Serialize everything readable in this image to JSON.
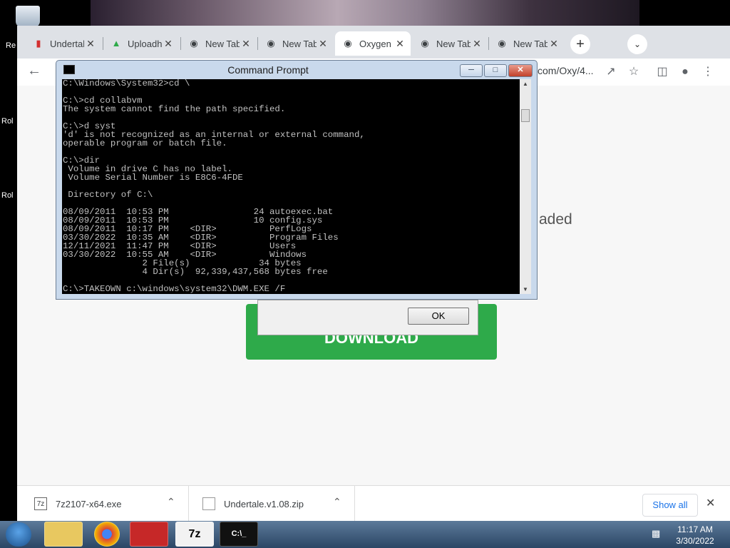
{
  "desktop": {
    "recycle_label": "Re",
    "icon2_label": "Rol",
    "icon3_label": "Rol"
  },
  "browser": {
    "tabs": [
      {
        "title": "Undertale",
        "icon": "red-shield-icon"
      },
      {
        "title": "Uploadh",
        "icon": "upload-icon"
      },
      {
        "title": "New Tab",
        "icon": "chrome-icon"
      },
      {
        "title": "New Tab",
        "icon": "chrome-icon"
      },
      {
        "title": "Oxygen",
        "icon": "globe-icon",
        "active": true
      },
      {
        "title": "New Tab",
        "icon": "chrome-icon"
      },
      {
        "title": "New Tab",
        "icon": "chrome-icon"
      }
    ],
    "url_tail": "com/Oxy/4...",
    "page_text": "aded",
    "download_button_label": "DOWNLOAD",
    "dialog_ok": "OK",
    "downloads": [
      {
        "name": "7z2107-x64.exe",
        "icon": "7z-icon"
      },
      {
        "name": "Undertale.v1.08.zip",
        "icon": "zip-file-icon"
      }
    ],
    "show_all": "Show all"
  },
  "cmd": {
    "title": "Command Prompt",
    "lines": [
      "C:\\Windows\\System32>cd \\",
      "",
      "C:\\>cd collabvm",
      "The system cannot find the path specified.",
      "",
      "C:\\>d syst",
      "'d' is not recognized as an internal or external command,",
      "operable program or batch file.",
      "",
      "C:\\>dir",
      " Volume in drive C has no label.",
      " Volume Serial Number is E8C6-4FDE",
      "",
      " Directory of C:\\",
      "",
      "08/09/2011  10:53 PM                24 autoexec.bat",
      "08/09/2011  10:53 PM                10 config.sys",
      "08/09/2011  10:17 PM    <DIR>          PerfLogs",
      "03/30/2022  10:35 AM    <DIR>          Program Files",
      "12/11/2021  11:47 PM    <DIR>          Users",
      "03/30/2022  10:55 AM    <DIR>          Windows",
      "               2 File(s)             34 bytes",
      "               4 Dir(s)  92,339,437,568 bytes free",
      "",
      "C:\\>TAKEOWN c:\\windows\\system32\\DWM.EXE /F"
    ]
  },
  "taskbar": {
    "buttons": [
      {
        "name": "explorer-taskbar-button",
        "label": ""
      },
      {
        "name": "chrome-taskbar-button",
        "label": ""
      },
      {
        "name": "defender-taskbar-button",
        "label": ""
      },
      {
        "name": "7zip-taskbar-button",
        "label": "7z"
      },
      {
        "name": "cmd-taskbar-button",
        "label": "C:\\_"
      }
    ],
    "time": "11:17 AM",
    "date": "3/30/2022"
  }
}
